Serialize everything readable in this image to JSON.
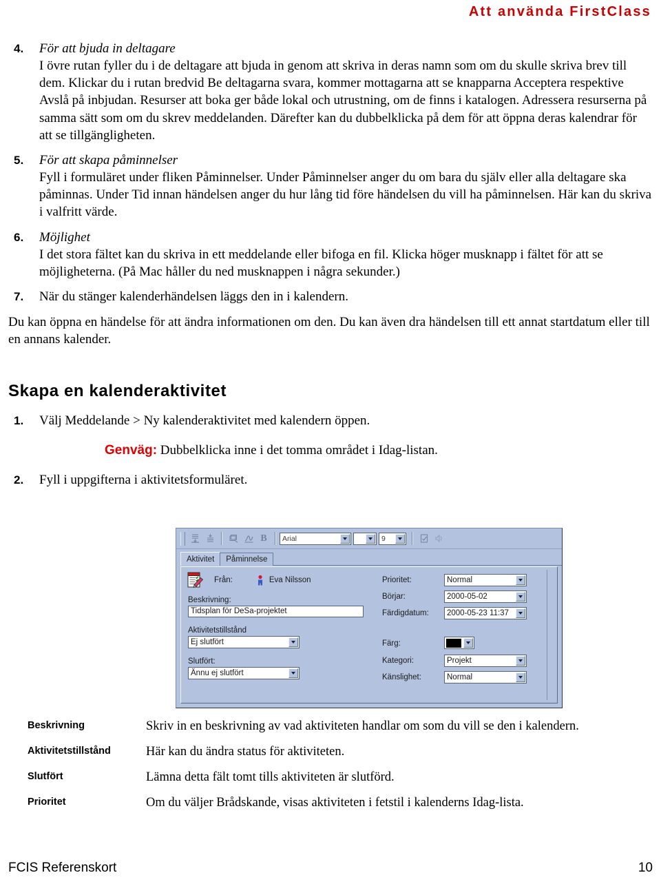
{
  "header": {
    "running_head": "Att använda FirstClass"
  },
  "steps": [
    {
      "num": "4.",
      "title": "För att bjuda in deltagare",
      "body": "I övre rutan fyller du i de deltagare att bjuda in genom att skriva in deras namn som om du skulle skriva brev till dem. Klickar du i rutan bredvid Be deltagarna svara, kommer mottagarna att se knapparna Acceptera respektive Avslå på inbjudan. Resurser att boka ger både lokal och utrustning, om de finns i katalogen. Adressera resurserna på samma sätt som om du skrev meddelanden. Därefter kan du dubbelklicka på dem för att öppna deras kalendrar för att se tillgängligheten."
    },
    {
      "num": "5.",
      "title": "För att skapa påminnelser",
      "body": "Fyll i formuläret under fliken Påminnelser. Under Påminnelser anger du om bara du själv eller alla deltagare ska påminnas. Under Tid innan händelsen anger du hur lång tid före händelsen du vill ha påminnelsen. Här kan du skriva i valfritt värde."
    },
    {
      "num": "6.",
      "title": "Möjlighet",
      "body": "I det stora fältet kan du skriva in ett meddelande eller bifoga en fil. Klicka höger musknapp i fältet för att se möjligheterna. (På Mac håller du ned musknappen i några sekunder.)"
    },
    {
      "num": "7.",
      "title": "",
      "body": "När du stänger kalenderhändelsen läggs den in i kalendern."
    }
  ],
  "closing_paragraph": "Du kan öppna en händelse för att ändra informationen om den. Du kan även dra händelsen till ett annat startdatum eller till en annans kalender.",
  "section": {
    "heading": "Skapa en kalenderaktivitet",
    "steps": [
      {
        "num": "1.",
        "text": "Välj Meddelande > Ny kalenderaktivitet med kalendern öppen."
      },
      {
        "num": "2.",
        "text": "Fyll i uppgifterna i aktivitetsformuläret."
      }
    ],
    "tip": {
      "label": "Genväg:",
      "text": "Dubbelklicka inne i det tomma området i Idag-listan."
    }
  },
  "dialog": {
    "toolbar": {
      "icons": [
        "indent-decrease-icon",
        "indent-increase-icon",
        "attach-icon",
        "signature-icon",
        "bold-icon",
        "document-check-icon",
        "sound-icon"
      ],
      "bold_label": "B",
      "font_value": "Arial",
      "style_value": "",
      "size_value": "9"
    },
    "tabs": [
      {
        "label": "Aktivitet",
        "active": true
      },
      {
        "label": "Påminnelse",
        "active": false
      }
    ],
    "from": {
      "label": "Från:",
      "name": "Eva Nilsson"
    },
    "left_fields": [
      {
        "label": "Beskrivning:",
        "value": "Tidsplan för DeSa-projektet",
        "kind": "text"
      },
      {
        "label": "Aktivitetstillstånd",
        "value": "Ej slutfört",
        "kind": "drop"
      },
      {
        "label": "Slutfört:",
        "value": "Ännu ej slutfört",
        "kind": "drop"
      }
    ],
    "right_fields": [
      {
        "label": "Prioritet:",
        "value": "Normal",
        "kind": "drop"
      },
      {
        "label": "Börjar:",
        "value": "2000-05-02",
        "kind": "drop"
      },
      {
        "label": "Färdigdatum:",
        "value": "2000-05-23 11:37",
        "kind": "drop"
      },
      {
        "label": "Färg:",
        "value": "",
        "kind": "color",
        "color": "#000000"
      },
      {
        "label": "Kategori:",
        "value": "Projekt",
        "kind": "drop"
      },
      {
        "label": "Känslighet:",
        "value": "Normal",
        "kind": "drop"
      }
    ]
  },
  "definitions": [
    {
      "term": "Beskrivning",
      "desc": "Skriv in en beskrivning av vad aktiviteten handlar om som du vill se den i kalendern."
    },
    {
      "term": "Aktivitetstillstånd",
      "desc": "Här kan du ändra status för aktiviteten."
    },
    {
      "term": "Slutfört",
      "desc": "Lämna detta fält tomt tills aktiviteten är slutförd."
    },
    {
      "term": "Prioritet",
      "desc": "Om du väljer Brådskande, visas aktiviteten i fetstil i kalenderns Idag-lista."
    }
  ],
  "footer": {
    "left": "FCIS Referenskort",
    "right": "10"
  }
}
